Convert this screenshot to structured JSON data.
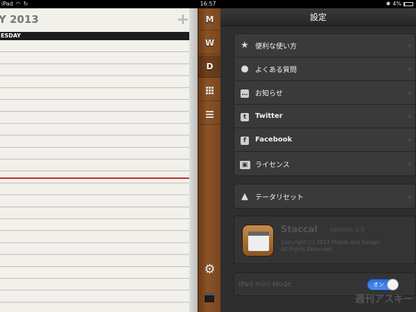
{
  "status_bar": {
    "device": "iPad",
    "time": "16:57",
    "battery": "4%"
  },
  "notebook": {
    "title": "Y 2013",
    "add_symbol": "+",
    "day_label": "ESDAY"
  },
  "side_tabs": {
    "items": [
      "M",
      "W",
      "D"
    ],
    "active": "D"
  },
  "settings": {
    "title": "設定",
    "group1": [
      {
        "label": "便利な使い方",
        "icon": "star-icon"
      },
      {
        "label": "よくある質問",
        "icon": "lightbulb-icon"
      },
      {
        "label": "お知らせ",
        "icon": "speech-bubble-icon"
      },
      {
        "label": "Twitter",
        "icon": "twitter-icon"
      },
      {
        "label": "Facebook",
        "icon": "facebook-icon"
      },
      {
        "label": "ライセンス",
        "icon": "id-card-icon"
      }
    ],
    "reset_label": "テータリセット",
    "about": {
      "app_name": "Staccal",
      "version": "version 1.0",
      "copyright": "Copyright (c) 2013 Mobile and Design",
      "rights": "All Rights Reserved."
    },
    "mini_mode": {
      "label": "iPad mini Mode",
      "toggle_label": "オン",
      "enabled": true
    }
  },
  "watermark": "週刊アスキー",
  "colors": {
    "toggle_on": "#3a82e4",
    "red_line": "#c42a2a"
  }
}
